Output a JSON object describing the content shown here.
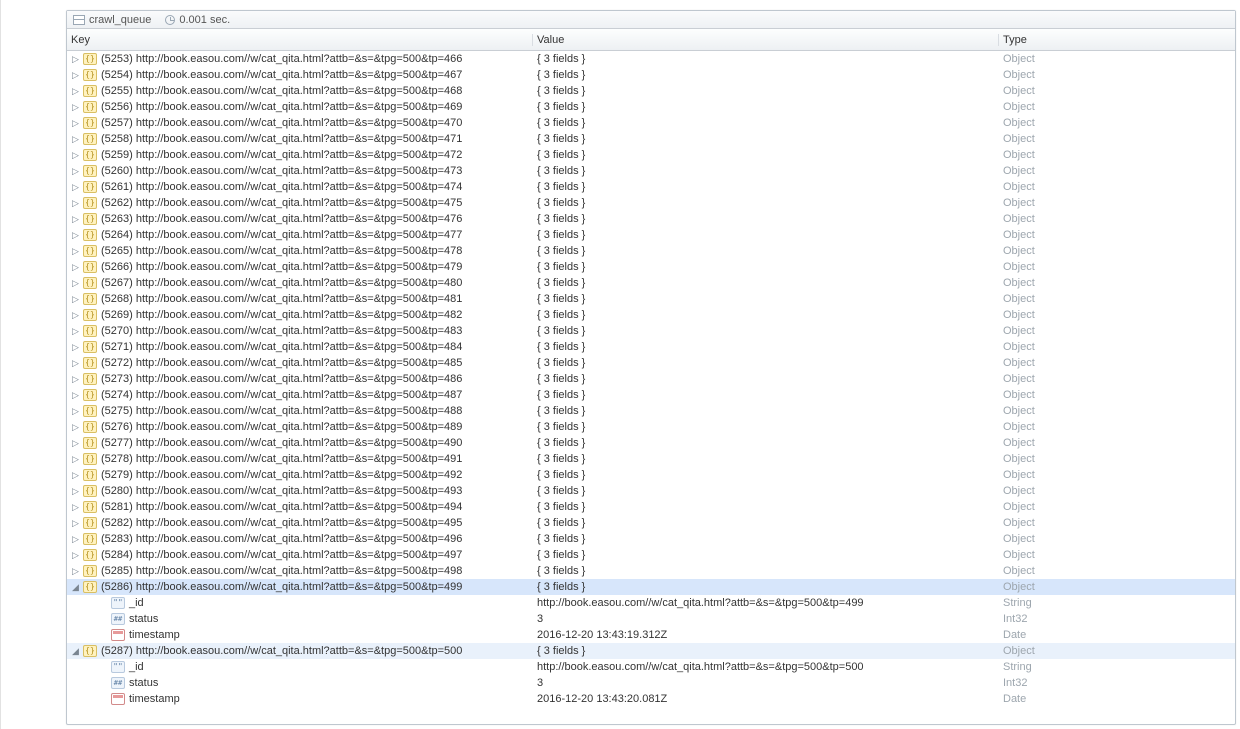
{
  "tabbar": {
    "title": "crawl_queue",
    "timing": "0.001 sec."
  },
  "columns": {
    "key": "Key",
    "value": "Value",
    "type": "Type"
  },
  "object_value_label": "{ 3 fields }",
  "object_type_label": "Object",
  "url_prefix": "http://book.easou.com//w/cat_qita.html?attb=&s=&tpg=500&tp=",
  "collapsed": [
    {
      "idx": "5253",
      "tp": "466"
    },
    {
      "idx": "5254",
      "tp": "467"
    },
    {
      "idx": "5255",
      "tp": "468"
    },
    {
      "idx": "5256",
      "tp": "469"
    },
    {
      "idx": "5257",
      "tp": "470"
    },
    {
      "idx": "5258",
      "tp": "471"
    },
    {
      "idx": "5259",
      "tp": "472"
    },
    {
      "idx": "5260",
      "tp": "473"
    },
    {
      "idx": "5261",
      "tp": "474"
    },
    {
      "idx": "5262",
      "tp": "475"
    },
    {
      "idx": "5263",
      "tp": "476"
    },
    {
      "idx": "5264",
      "tp": "477"
    },
    {
      "idx": "5265",
      "tp": "478"
    },
    {
      "idx": "5266",
      "tp": "479"
    },
    {
      "idx": "5267",
      "tp": "480"
    },
    {
      "idx": "5268",
      "tp": "481"
    },
    {
      "idx": "5269",
      "tp": "482"
    },
    {
      "idx": "5270",
      "tp": "483"
    },
    {
      "idx": "5271",
      "tp": "484"
    },
    {
      "idx": "5272",
      "tp": "485"
    },
    {
      "idx": "5273",
      "tp": "486"
    },
    {
      "idx": "5274",
      "tp": "487"
    },
    {
      "idx": "5275",
      "tp": "488"
    },
    {
      "idx": "5276",
      "tp": "489"
    },
    {
      "idx": "5277",
      "tp": "490"
    },
    {
      "idx": "5278",
      "tp": "491"
    },
    {
      "idx": "5279",
      "tp": "492"
    },
    {
      "idx": "5280",
      "tp": "493"
    },
    {
      "idx": "5281",
      "tp": "494"
    },
    {
      "idx": "5282",
      "tp": "495"
    },
    {
      "idx": "5283",
      "tp": "496"
    },
    {
      "idx": "5284",
      "tp": "497"
    },
    {
      "idx": "5285",
      "tp": "498"
    }
  ],
  "expanded": [
    {
      "idx": "5286",
      "tp": "499",
      "selected": true,
      "fields": [
        {
          "key": "_id",
          "value": "http://book.easou.com//w/cat_qita.html?attb=&s=&tpg=500&tp=499",
          "type": "String",
          "icon": "str"
        },
        {
          "key": "status",
          "value": "3",
          "type": "Int32",
          "icon": "int"
        },
        {
          "key": "timestamp",
          "value": "2016-12-20 13:43:19.312Z",
          "type": "Date",
          "icon": "date"
        }
      ]
    },
    {
      "idx": "5287",
      "tp": "500",
      "selected": false,
      "fields": [
        {
          "key": "_id",
          "value": "http://book.easou.com//w/cat_qita.html?attb=&s=&tpg=500&tp=500",
          "type": "String",
          "icon": "str"
        },
        {
          "key": "status",
          "value": "3",
          "type": "Int32",
          "icon": "int"
        },
        {
          "key": "timestamp",
          "value": "2016-12-20 13:43:20.081Z",
          "type": "Date",
          "icon": "date"
        }
      ]
    }
  ]
}
